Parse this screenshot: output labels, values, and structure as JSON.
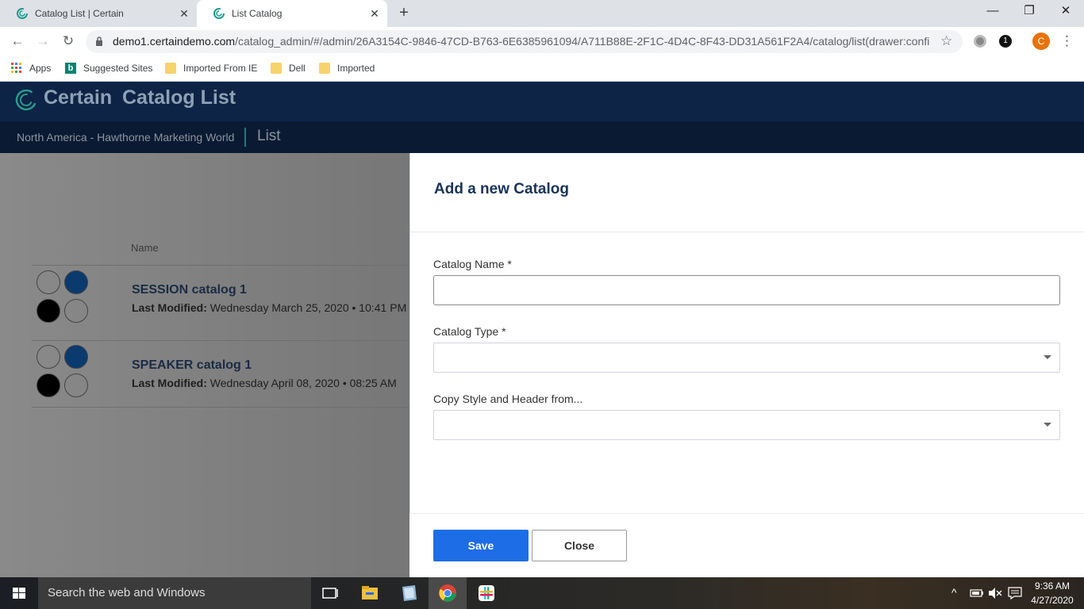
{
  "browser": {
    "tabs": [
      {
        "title": "Catalog List | Certain",
        "active": false
      },
      {
        "title": "List Catalog",
        "active": true
      }
    ],
    "url_host": "demo1.certaindemo.com",
    "url_path": "/catalog_admin/#/admin/26A3154C-9846-47CD-B763-6E6385961094/A711B88E-2F1C-4D4C-8F43-DD31A561F2A4/catalog/list(drawer:confi...",
    "profile_initial": "C",
    "bookmarks": [
      "Apps",
      "Suggested Sites",
      "Imported From IE",
      "Dell",
      "Imported"
    ]
  },
  "app": {
    "brand": "Certain",
    "title": "Catalog List",
    "event": "North America - Hawthorne Marketing World",
    "breadcrumb": "List",
    "colors": {
      "header": "#0e2446",
      "accent": "#1d6ee6"
    }
  },
  "list": {
    "column_name": "Name",
    "modified_label": "Last Modified:",
    "items": [
      {
        "name": "SESSION catalog 1",
        "modified": "Wednesday March 25, 2020 • 10:41 PM"
      },
      {
        "name": "SPEAKER catalog 1",
        "modified": "Wednesday April 08, 2020 • 08:25 AM"
      }
    ]
  },
  "drawer": {
    "title": "Add a new Catalog",
    "fields": {
      "name_label": "Catalog Name *",
      "name_value": "",
      "type_label": "Catalog Type *",
      "type_value": "",
      "copy_label": "Copy Style and Header from...",
      "copy_value": ""
    },
    "save": "Save",
    "close": "Close"
  },
  "taskbar": {
    "search_placeholder": "Search the web and Windows",
    "time": "9:36 AM",
    "date": "4/27/2020"
  }
}
